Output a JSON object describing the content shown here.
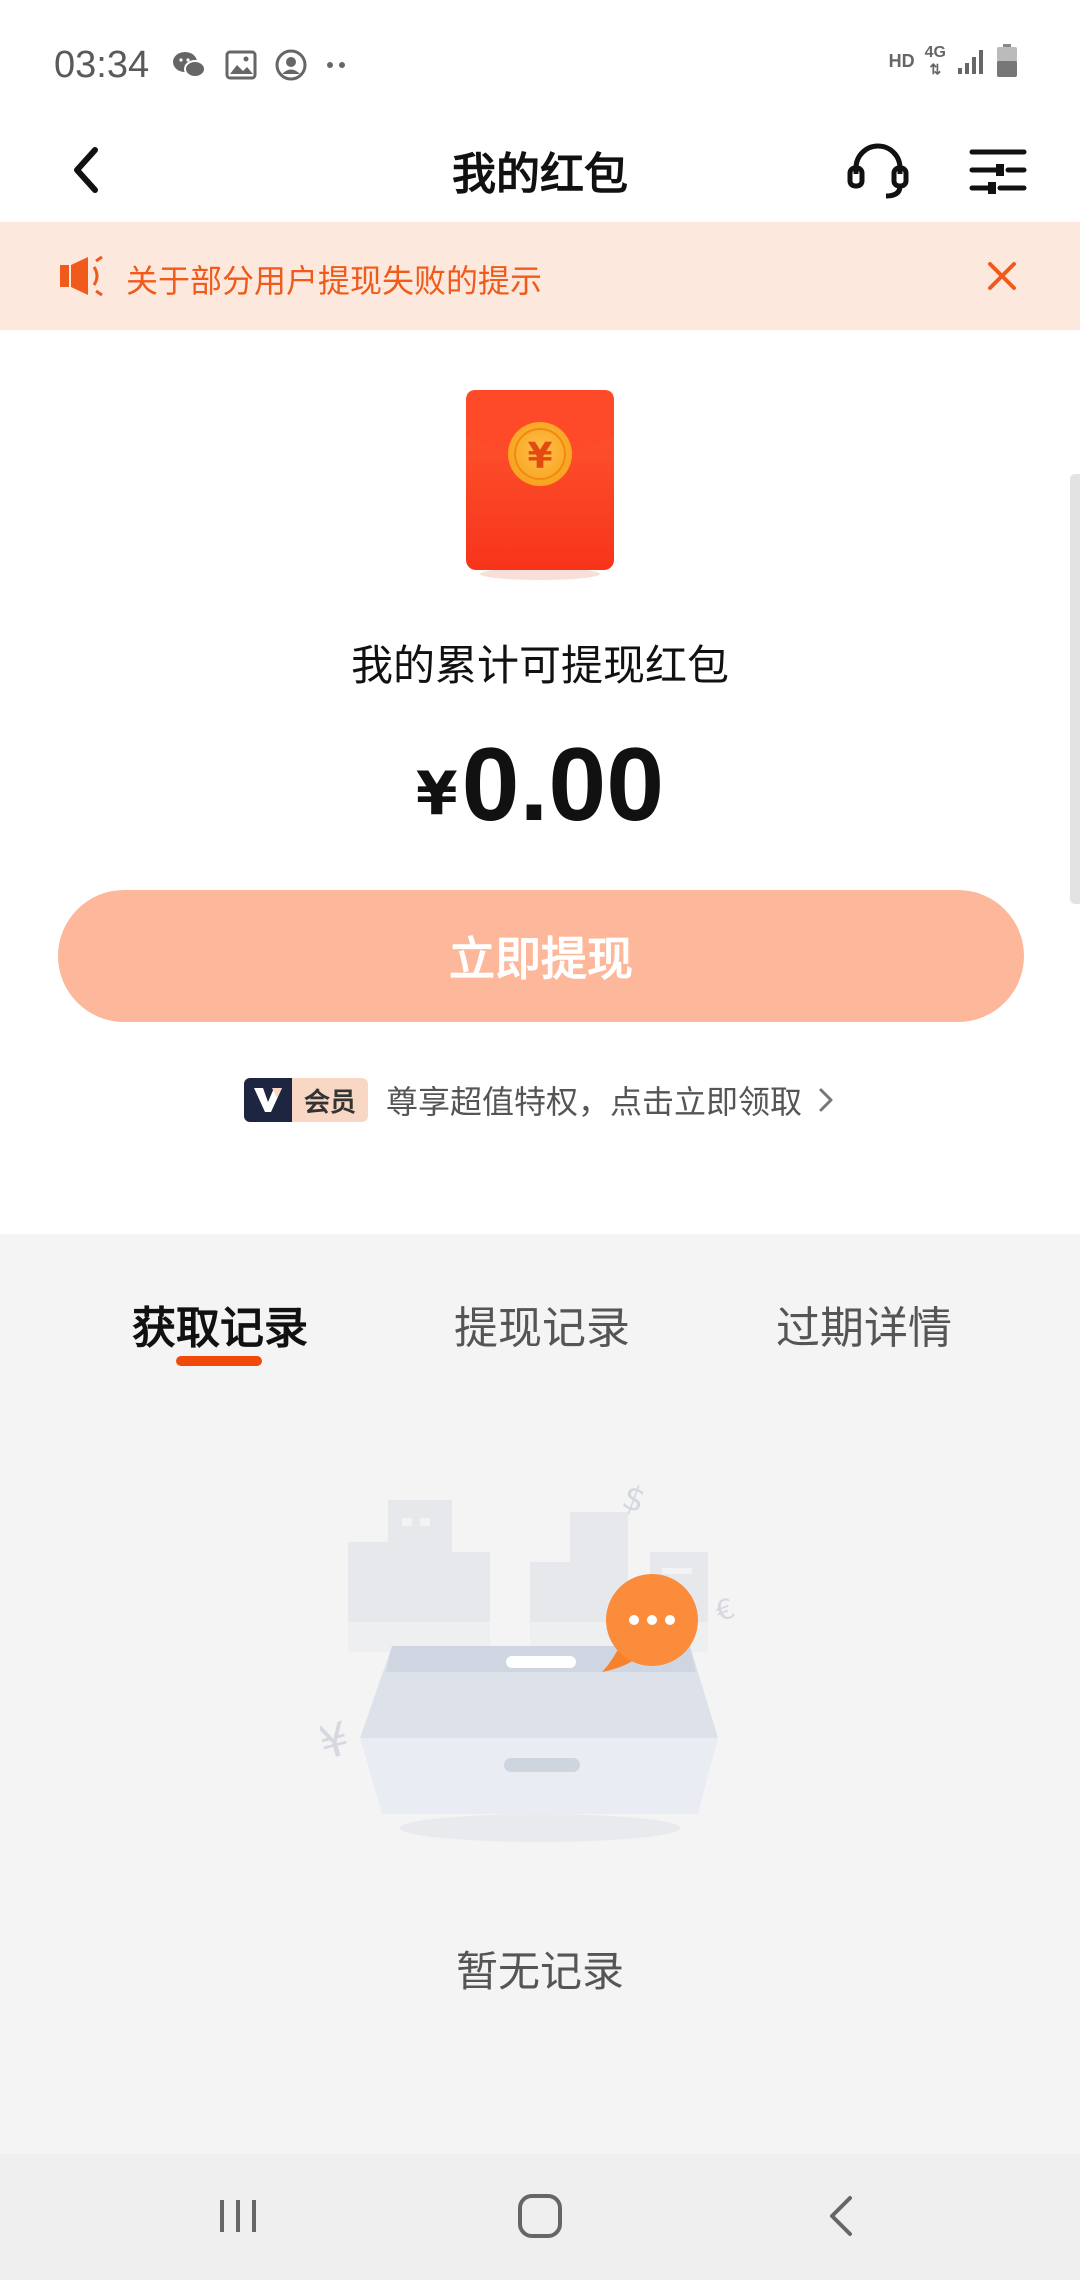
{
  "status_bar": {
    "time": "03:34",
    "hd": "HD",
    "network": "4G"
  },
  "header": {
    "title": "我的红包"
  },
  "notice": {
    "text": "关于部分用户提现失败的提示"
  },
  "wallet": {
    "subtitle": "我的累计可提现红包",
    "currency": "¥",
    "amount": "0.00",
    "withdraw_label": "立即提现"
  },
  "vip": {
    "badge_label": "会员",
    "text": "尊享超值特权，点击立即领取"
  },
  "tabs": [
    {
      "label": "获取记录",
      "active": true
    },
    {
      "label": "提现记录",
      "active": false
    },
    {
      "label": "过期详情",
      "active": false
    }
  ],
  "empty_state": {
    "text": "暂无记录"
  },
  "colors": {
    "accent": "#f04a0a",
    "notice_bg": "#fde8dd",
    "notice_text": "#f05a1a",
    "button_disabled": "#fdb89b",
    "lower_bg": "#f4f4f5"
  }
}
